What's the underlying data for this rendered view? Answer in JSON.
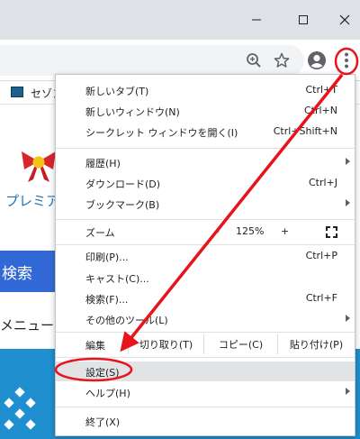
{
  "window": {
    "minimize_icon": "minimize-icon",
    "maximize_icon": "maximize-icon",
    "close_icon": "close-icon"
  },
  "toolbar": {
    "zoom_icon": "zoom-icon",
    "star_icon": "star-icon",
    "profile_icon": "profile-icon",
    "menu_icon": "three-dot-menu-icon"
  },
  "bookmarks": {
    "items": [
      {
        "label": "セゾン"
      }
    ]
  },
  "page": {
    "premium_text": "プレミア",
    "search_button": "検索",
    "menu_text": "メニュー"
  },
  "menu": {
    "new_tab": {
      "label": "新しいタブ(T)",
      "shortcut": "Ctrl+T"
    },
    "new_window": {
      "label": "新しいウィンドウ(N)",
      "shortcut": "Ctrl+N"
    },
    "incognito": {
      "label": "シークレット ウィンドウを開く(I)",
      "shortcut": "Ctrl+Shift+N"
    },
    "history": {
      "label": "履歴(H)"
    },
    "downloads": {
      "label": "ダウンロード(D)",
      "shortcut": "Ctrl+J"
    },
    "bookmarks": {
      "label": "ブックマーク(B)"
    },
    "zoom": {
      "label": "ズーム",
      "minus": "-",
      "value": "125%",
      "plus": "+"
    },
    "print": {
      "label": "印刷(P)...",
      "shortcut": "Ctrl+P"
    },
    "cast": {
      "label": "キャスト(C)..."
    },
    "find": {
      "label": "検索(F)...",
      "shortcut": "Ctrl+F"
    },
    "more_tools": {
      "label": "その他のツール(L)"
    },
    "edit": {
      "label": "編集",
      "cut": "切り取り(T)",
      "copy": "コピー(C)",
      "paste": "貼り付け(P)"
    },
    "settings": {
      "label": "設定(S)"
    },
    "help": {
      "label": "ヘルプ(H)"
    },
    "exit": {
      "label": "終了(X)"
    }
  },
  "colors": {
    "annotation": "#e8141b",
    "chrome_bg": "#dee1e6",
    "highlight": "#e2e3e4"
  }
}
